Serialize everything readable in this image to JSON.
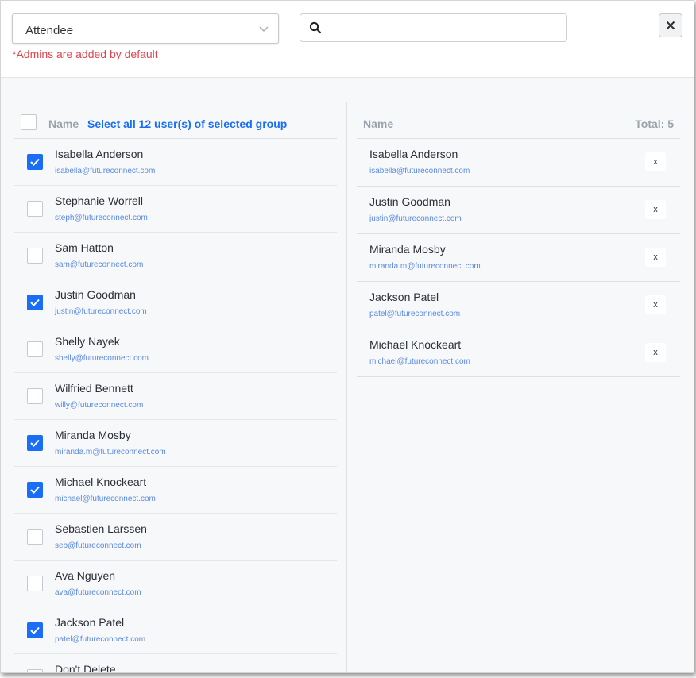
{
  "header": {
    "role_select": {
      "value": "Attendee"
    },
    "hint": "*Admins are added by default",
    "search": {
      "placeholder": "",
      "value": ""
    },
    "close_icon": "close-icon"
  },
  "left": {
    "column_name": "Name",
    "select_all_label": "Select all 12 user(s) of selected group",
    "users": [
      {
        "name": "Isabella Anderson",
        "email": "isabella@futureconnect.com",
        "checked": true
      },
      {
        "name": "Stephanie Worrell",
        "email": "steph@futureconnect.com",
        "checked": false
      },
      {
        "name": "Sam Hatton",
        "email": "sam@futureconnect.com",
        "checked": false
      },
      {
        "name": "Justin Goodman",
        "email": "justin@futureconnect.com",
        "checked": true
      },
      {
        "name": "Shelly Nayek",
        "email": "shelly@futureconnect.com",
        "checked": false
      },
      {
        "name": "Wilfried Bennett",
        "email": "willy@futureconnect.com",
        "checked": false
      },
      {
        "name": "Miranda Mosby",
        "email": "miranda.m@futureconnect.com",
        "checked": true
      },
      {
        "name": "Michael Knockeart",
        "email": "michael@futureconnect.com",
        "checked": true
      },
      {
        "name": "Sebastien Larssen",
        "email": "seb@futureconnect.com",
        "checked": false
      },
      {
        "name": "Ava Nguyen",
        "email": "ava@futureconnect.com",
        "checked": false
      },
      {
        "name": "Jackson Patel",
        "email": "patel@futureconnect.com",
        "checked": true
      },
      {
        "name": "Don't Delete",
        "email": "",
        "checked": false
      }
    ]
  },
  "right": {
    "column_name": "Name",
    "total_label": "Total: 5",
    "remove_label": "x",
    "selected": [
      {
        "name": "Isabella Anderson",
        "email": "isabella@futureconnect.com"
      },
      {
        "name": "Justin Goodman",
        "email": "justin@futureconnect.com"
      },
      {
        "name": "Miranda Mosby",
        "email": "miranda.m@futureconnect.com"
      },
      {
        "name": "Jackson Patel",
        "email": "patel@futureconnect.com"
      },
      {
        "name": "Michael Knockeart",
        "email": "michael@futureconnect.com"
      }
    ]
  },
  "colors": {
    "accent": "#1a6ef5",
    "hint": "#e0444e",
    "email": "#5a8ae0"
  }
}
